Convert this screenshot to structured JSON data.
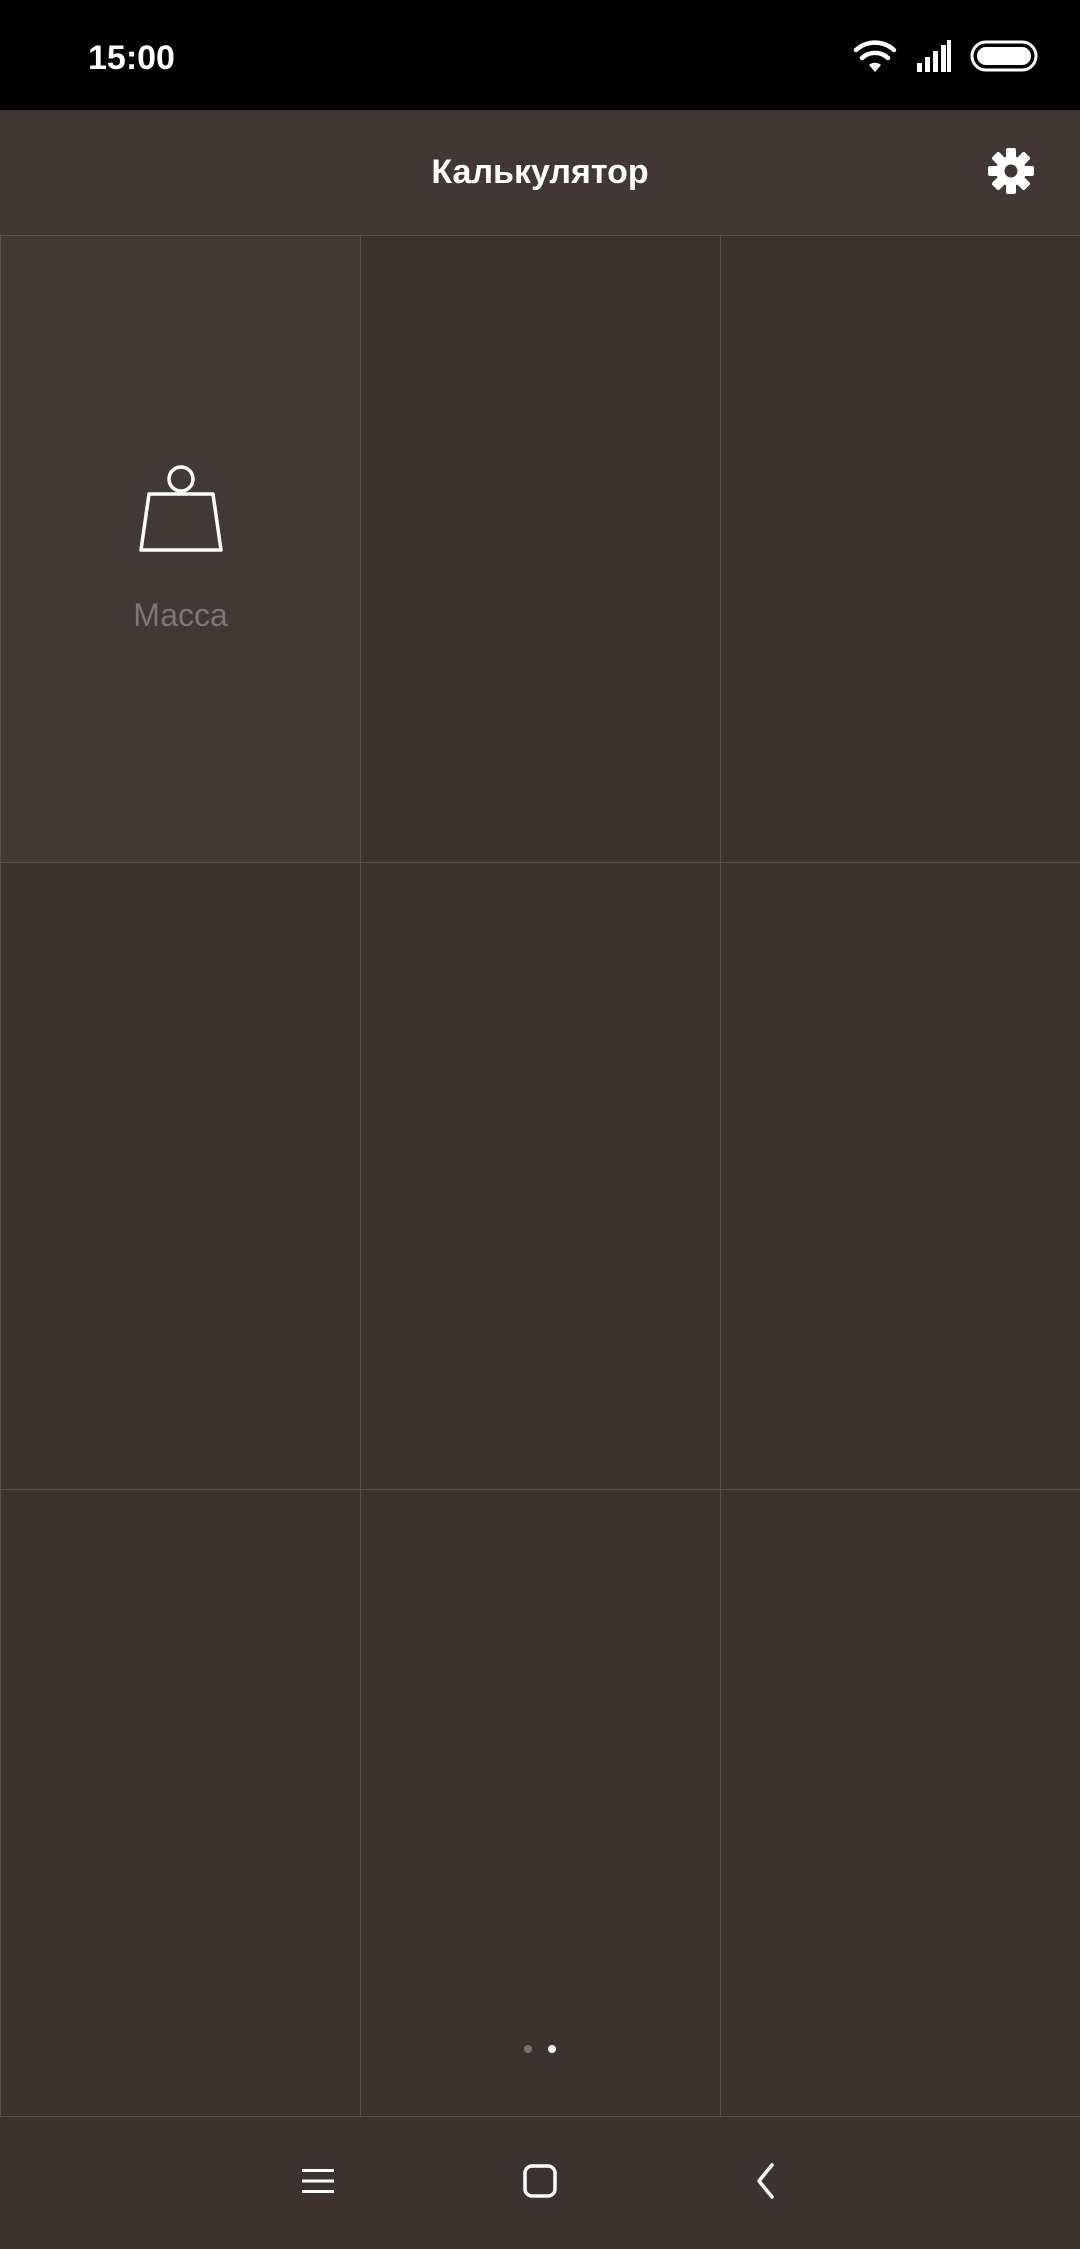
{
  "status_bar": {
    "time": "15:00",
    "icons": [
      "wifi-icon",
      "signal-icon",
      "battery-icon"
    ]
  },
  "header": {
    "title": "Калькулятор",
    "settings_icon": "gear-icon"
  },
  "grid": {
    "columns": 3,
    "rows": 3,
    "tiles": [
      {
        "label": "Масса",
        "icon": "weight-icon"
      },
      {
        "label": "",
        "icon": ""
      },
      {
        "label": "",
        "icon": ""
      },
      {
        "label": "",
        "icon": ""
      },
      {
        "label": "",
        "icon": ""
      },
      {
        "label": "",
        "icon": ""
      },
      {
        "label": "",
        "icon": ""
      },
      {
        "label": "",
        "icon": ""
      },
      {
        "label": "",
        "icon": ""
      }
    ]
  },
  "pager": {
    "page_count": 2,
    "current_page": 2
  },
  "nav_bar": {
    "buttons": [
      "menu-icon",
      "home-icon",
      "back-icon"
    ]
  },
  "colors": {
    "background": "#3c3331",
    "app_bar": "#423735",
    "status_bar": "#000000",
    "grid_line": "#5a504e",
    "tile_label": "#7f7775"
  }
}
